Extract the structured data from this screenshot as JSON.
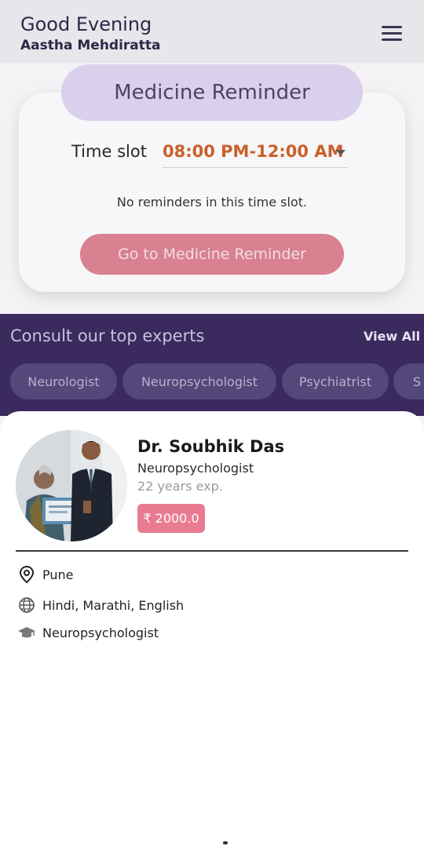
{
  "header": {
    "greeting": "Good Evening",
    "user_name": "Aastha Mehdiratta",
    "menu_icon": "hamburger-menu-icon"
  },
  "reminder": {
    "title": "Medicine Reminder",
    "time_slot_label": "Time slot",
    "time_slot_value": "08:00 PM-12:00 AM",
    "empty_message": "No reminders in this time slot.",
    "button_label": "Go to Medicine Reminder"
  },
  "experts": {
    "title": "Consult our top experts",
    "view_all": "View All",
    "chips": [
      "Neurologist",
      "Neuropsychologist",
      "Psychiatrist",
      "S"
    ]
  },
  "doctor": {
    "name": "Dr. Soubhik Das",
    "specialty": "Neuropsychologist",
    "experience": "22 years exp.",
    "fee": "₹ 2000.0",
    "location": "Pune",
    "languages": "Hindi, Marathi, English",
    "qualification": "Neuropsychologist"
  },
  "colors": {
    "accent_purple": "#3a2a5e",
    "fee_pink": "#e97b90",
    "time_orange": "#c9602a"
  }
}
